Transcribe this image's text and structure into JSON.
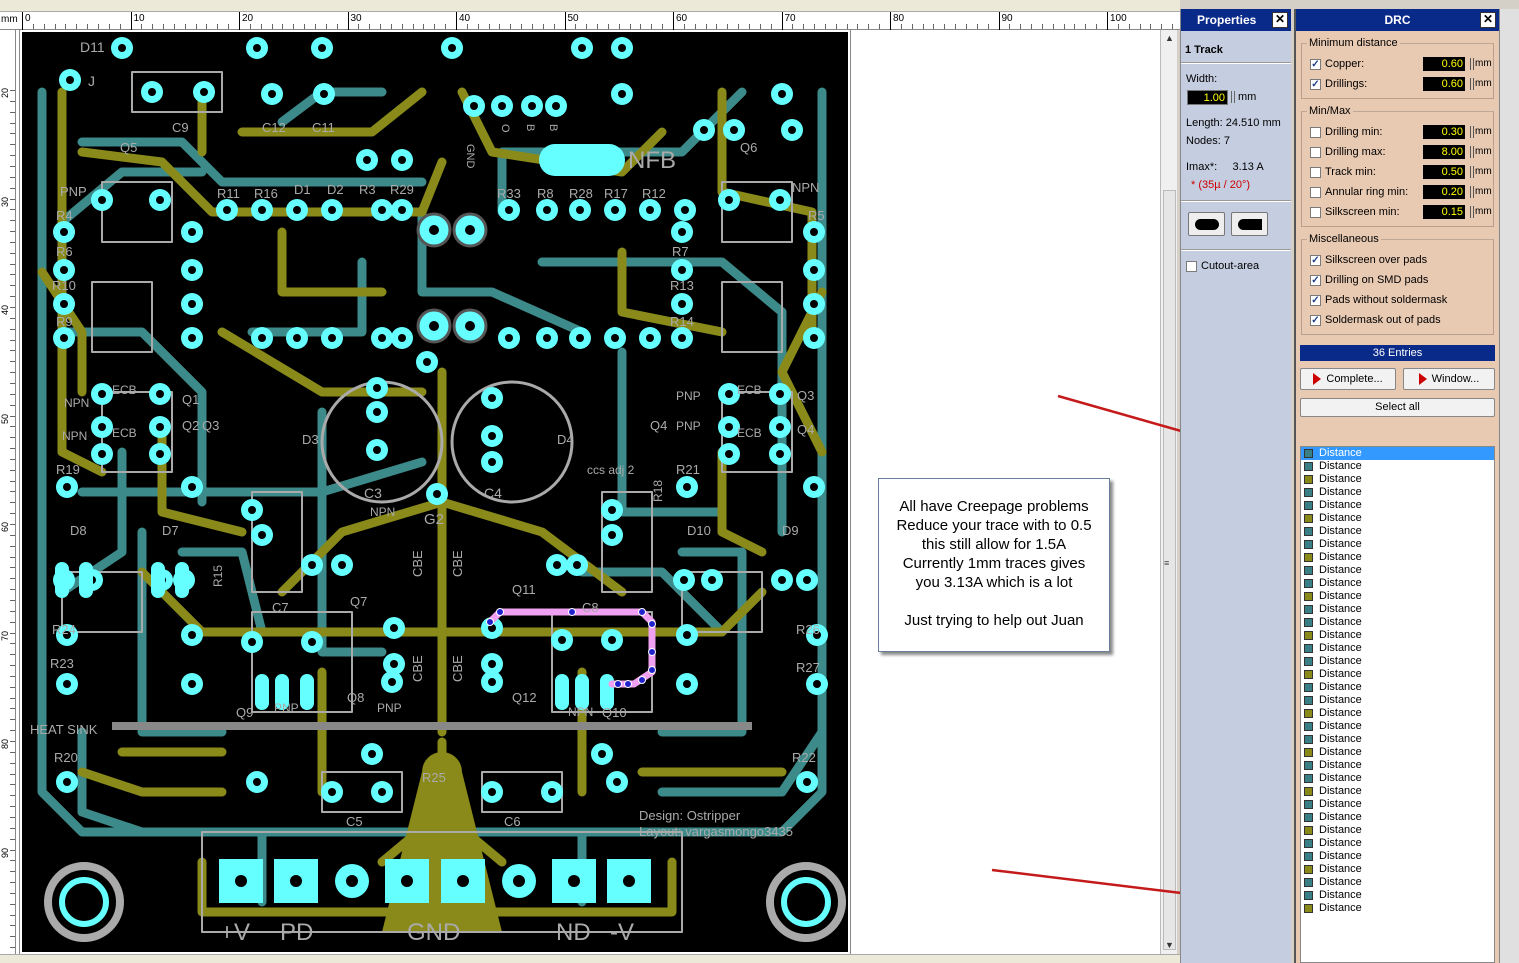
{
  "ruler": {
    "unit": "mm",
    "top_labels": [
      "0",
      "10",
      "20",
      "30",
      "40",
      "50",
      "60",
      "70",
      "80",
      "90",
      "100"
    ],
    "left_labels": [
      "20",
      "30",
      "40",
      "50",
      "60",
      "70",
      "80",
      "90"
    ]
  },
  "board_text": {
    "refdes": [
      "D11",
      "J",
      "C9",
      "C12",
      "C11",
      "D1",
      "D2",
      "R3",
      "R29",
      "R11",
      "R16",
      "R33",
      "R8",
      "R28",
      "R17",
      "R12",
      "Q5",
      "Q6",
      "PNP",
      "NPN",
      "R4",
      "R6",
      "R10",
      "R9",
      "R5",
      "R7",
      "R13",
      "R14",
      "NFB",
      "GND",
      "O",
      "B",
      "B",
      "R9",
      "Q1",
      "Q2",
      "Q3",
      "Q4",
      "D3",
      "D4",
      "C3",
      "C4",
      "R21",
      "R19",
      "R18",
      "D8",
      "D7",
      "D10",
      "D9",
      "R15",
      "C7",
      "Q7",
      "Q8",
      "Q9",
      "Q10",
      "Q11",
      "Q12",
      "R24",
      "R23",
      "R26",
      "R27",
      "R20",
      "R22",
      "R25",
      "C5",
      "C6",
      "G2",
      "HEAT SINK",
      "ccs adj 2",
      "NPN",
      "PNP",
      "ECB",
      "CBE"
    ],
    "credits": [
      "Design: Ostripper",
      "Layout: vargasmongo3435"
    ],
    "connectors": [
      "+V",
      "PD",
      "GND",
      "ND",
      "-V"
    ]
  },
  "note": {
    "lines": [
      "All have Creepage problems",
      "Reduce your trace with to 0.5",
      "this still allow for 1.5A",
      "Currently 1mm traces gives",
      "you 3.13A which is a lot",
      "",
      "Just trying to help out Juan"
    ]
  },
  "properties": {
    "title": "Properties",
    "close": "✕",
    "heading": "1 Track",
    "width_label": "Width:",
    "width_value": "1.00",
    "width_unit": "mm",
    "length": "Length:  24.510 mm",
    "nodes": "Nodes:   7",
    "imax_label": "Imax*:",
    "imax_value": "3.13 A",
    "imax_note": "* (35µ / 20°)",
    "cutout": "Cutout-area"
  },
  "drc": {
    "title": "DRC",
    "close": "✕",
    "min_distance": {
      "label": "Minimum distance",
      "rows": [
        {
          "label": "Copper:",
          "checked": true,
          "value": "0.60",
          "unit": "mm"
        },
        {
          "label": "Drillings:",
          "checked": true,
          "value": "0.60",
          "unit": "mm"
        }
      ]
    },
    "minmax": {
      "label": "Min/Max",
      "rows": [
        {
          "label": "Drilling min:",
          "checked": false,
          "value": "0.30",
          "unit": "mm"
        },
        {
          "label": "Drilling max:",
          "checked": false,
          "value": "8.00",
          "unit": "mm"
        },
        {
          "label": "Track min:",
          "checked": false,
          "value": "0.50",
          "unit": "mm"
        },
        {
          "label": "Annular ring min:",
          "checked": false,
          "value": "0.20",
          "unit": "mm"
        },
        {
          "label": "Silkscreen min:",
          "checked": false,
          "value": "0.15",
          "unit": "mm"
        }
      ]
    },
    "misc": {
      "label": "Miscellaneous",
      "rows": [
        {
          "label": "Silkscreen over pads",
          "checked": true
        },
        {
          "label": "Drilling on SMD pads",
          "checked": true
        },
        {
          "label": "Pads without soldermask",
          "checked": true
        },
        {
          "label": "Soldermask out of pads",
          "checked": true
        }
      ]
    },
    "entries": "36 Entries",
    "complete_btn": "Complete...",
    "window_btn": "Window...",
    "select_all": "Select all",
    "list_item": "Distance",
    "swatch_colors": [
      "#3a7f86",
      "#8a8a1a"
    ],
    "list_count": 36
  },
  "colors": {
    "copper_top": "#8a8a1a",
    "copper_bottom": "#3d8a8a",
    "pad": "#6ff",
    "silk": "#aaa",
    "selected_track": "#f0a0f0",
    "arrow": "#c41a1a"
  }
}
